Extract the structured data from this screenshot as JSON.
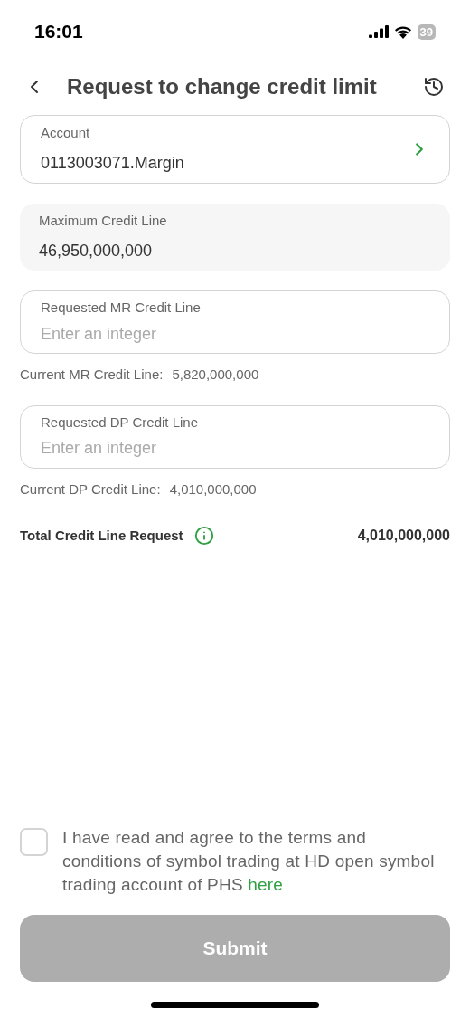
{
  "status_bar": {
    "time": "16:01",
    "battery": "39"
  },
  "header": {
    "title": "Request to change credit limit"
  },
  "account": {
    "label": "Account",
    "value": "0113003071.Margin"
  },
  "maximum": {
    "label": "Maximum Credit Line",
    "value": "46,950,000,000"
  },
  "requests": [
    {
      "label": "Requested MR Credit Line",
      "placeholder": "Enter an integer",
      "current_label": "Current MR Credit Line:",
      "current_value": "5,820,000,000"
    },
    {
      "label": "Requested DP Credit Line",
      "placeholder": "Enter an integer",
      "current_label": "Current DP Credit Line:",
      "current_value": "4,010,000,000"
    }
  ],
  "total": {
    "label": "Total Credit Line Request",
    "value": "4,010,000,000"
  },
  "agreement": {
    "checked": false,
    "text": "I have read and agree to the terms and conditions of symbol trading at HD open symbol trading account of PHS",
    "link": "here"
  },
  "submit": {
    "label": "Submit",
    "disabled": true
  }
}
